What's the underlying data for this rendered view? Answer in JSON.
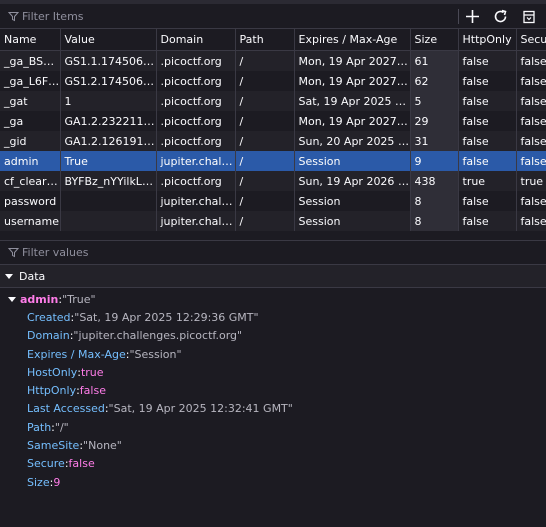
{
  "filter_items": {
    "placeholder": "Filter Items"
  },
  "toolbar": {
    "add_icon": "plus-icon",
    "refresh_icon": "refresh-icon",
    "delete_icon": "trash-icon"
  },
  "columns": [
    "Name",
    "Value",
    "Domain",
    "Path",
    "Expires / Max-Age",
    "Size",
    "HttpOnly",
    "Secure"
  ],
  "rows": [
    {
      "name": "_ga_BSZ…",
      "value": "GS1.1.1745065…",
      "domain": ".picoctf.org",
      "path": "/",
      "expires": "Mon, 19 Apr 2027 1…",
      "size": "61",
      "httponly": "false",
      "secure": "false"
    },
    {
      "name": "_ga_L6F…",
      "value": "GS1.2.1745065…",
      "domain": ".picoctf.org",
      "path": "/",
      "expires": "Mon, 19 Apr 2027 1…",
      "size": "62",
      "httponly": "false",
      "secure": "false"
    },
    {
      "name": "_gat",
      "value": "1",
      "domain": ".picoctf.org",
      "path": "/",
      "expires": "Sat, 19 Apr 2025 12:…",
      "size": "5",
      "httponly": "false",
      "secure": "false"
    },
    {
      "name": "_ga",
      "value": "GA1.2.2322118…",
      "domain": ".picoctf.org",
      "path": "/",
      "expires": "Mon, 19 Apr 2027 1…",
      "size": "29",
      "httponly": "false",
      "secure": "false"
    },
    {
      "name": "_gid",
      "value": "GA1.2.1261913…",
      "domain": ".picoctf.org",
      "path": "/",
      "expires": "Sun, 20 Apr 2025 1…",
      "size": "31",
      "httponly": "false",
      "secure": "false"
    },
    {
      "name": "admin",
      "value": "True",
      "domain": "jupiter.challe…",
      "path": "/",
      "expires": "Session",
      "size": "9",
      "httponly": "false",
      "secure": "false"
    },
    {
      "name": "cf_cleara…",
      "value": "BYFBz_nYYilkL…",
      "domain": ".picoctf.org",
      "path": "/",
      "expires": "Sun, 19 Apr 2026 12…",
      "size": "438",
      "httponly": "true",
      "secure": "true"
    },
    {
      "name": "password",
      "value": "",
      "domain": "jupiter.chall…",
      "path": "/",
      "expires": "Session",
      "size": "8",
      "httponly": "false",
      "secure": "false"
    },
    {
      "name": "username",
      "value": "",
      "domain": "jupiter.chall…",
      "path": "/",
      "expires": "Session",
      "size": "8",
      "httponly": "false",
      "secure": "false"
    }
  ],
  "selected_row": 5,
  "filter_values": {
    "placeholder": "Filter values"
  },
  "data_panel": {
    "title": "Data",
    "root_key": "admin",
    "root_value": "\"True\"",
    "props": [
      {
        "key": "Created",
        "value": "\"Sat, 19 Apr 2025 12:29:36 GMT\"",
        "type": "string"
      },
      {
        "key": "Domain",
        "value": "\"jupiter.challenges.picoctf.org\"",
        "type": "string"
      },
      {
        "key": "Expires / Max-Age",
        "value": "\"Session\"",
        "type": "string"
      },
      {
        "key": "HostOnly",
        "value": "true",
        "type": "bool"
      },
      {
        "key": "HttpOnly",
        "value": "false",
        "type": "bool"
      },
      {
        "key": "Last Accessed",
        "value": "\"Sat, 19 Apr 2025 12:32:41 GMT\"",
        "type": "string"
      },
      {
        "key": "Path",
        "value": "\"/\"",
        "type": "string"
      },
      {
        "key": "SameSite",
        "value": "\"None\"",
        "type": "string"
      },
      {
        "key": "Secure",
        "value": "false",
        "type": "bool"
      },
      {
        "key": "Size",
        "value": "9",
        "type": "number"
      }
    ]
  },
  "colors": {
    "selected": "#2b5aa8",
    "key": "#75bfff",
    "root_key": "#ff7de9"
  }
}
